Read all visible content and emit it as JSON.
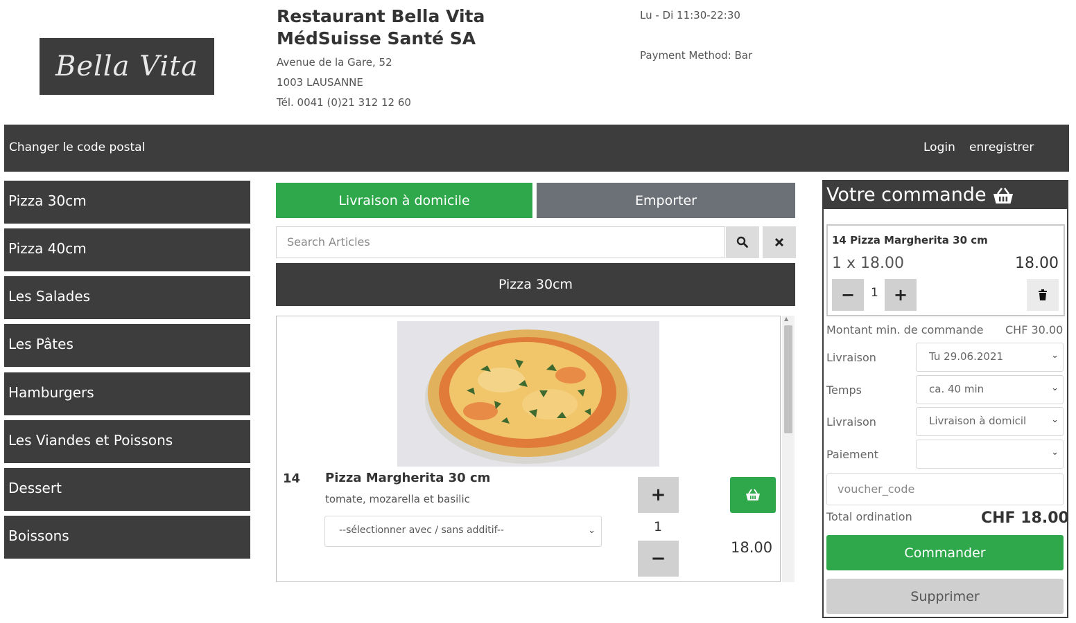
{
  "header": {
    "logo_text": "Bella Vita",
    "restaurant_name": "Restaurant Bella Vita",
    "company": "MédSuisse Santé SA",
    "address": "Avenue de la Gare, 52",
    "city": "1003 LAUSANNE",
    "phone": "Tél. 0041 (0)21 312 12 60",
    "hours": "Lu - Di 11:30-22:30",
    "payment_method": "Payment Method: Bar"
  },
  "topbar": {
    "change_postal": "Changer le code postal",
    "login": "Login",
    "register": "enregistrer"
  },
  "categories": [
    {
      "label": "Pizza 30cm"
    },
    {
      "label": "Pizza 40cm"
    },
    {
      "label": "Les Salades"
    },
    {
      "label": "Les Pâtes"
    },
    {
      "label": "Hamburgers"
    },
    {
      "label": "Les Viandes et Poissons"
    },
    {
      "label": "Dessert"
    },
    {
      "label": "Boissons"
    }
  ],
  "tabs": {
    "delivery": "Livraison à domicile",
    "takeaway": "Emporter"
  },
  "search": {
    "placeholder": "Search Articles"
  },
  "current_category": "Pizza 30cm",
  "product": {
    "number": "14",
    "name": "Pizza Margherita 30 cm",
    "description": "tomate, mozarella et basilic",
    "additive_select": "--sélectionner avec / sans additif--",
    "quantity": "1",
    "price": "18.00"
  },
  "order": {
    "title": "Votre commande",
    "item_name": "14 Pizza Margherita 30 cm",
    "item_qty_price": "1 x 18.00",
    "item_total": "18.00",
    "item_qty": "1",
    "min_order_label": "Montant min. de commande",
    "min_order_value": "CHF 30.00",
    "fields": {
      "delivery_date_label": "Livraison",
      "delivery_date_value": "Tu 29.06.2021",
      "time_label": "Temps",
      "time_value": "ca. 40 min",
      "delivery_type_label": "Livraison",
      "delivery_type_value": "Livraison à domicil",
      "payment_label": "Paiement",
      "payment_value": ""
    },
    "voucher_placeholder": "voucher_code",
    "total_label": "Total ordination",
    "total_value": "CHF 18.00",
    "order_button": "Commander",
    "delete_button": "Supprimer"
  },
  "colors": {
    "dark": "#3d3d3d",
    "green": "#2ea84a",
    "gray_tab": "#6b7177"
  }
}
